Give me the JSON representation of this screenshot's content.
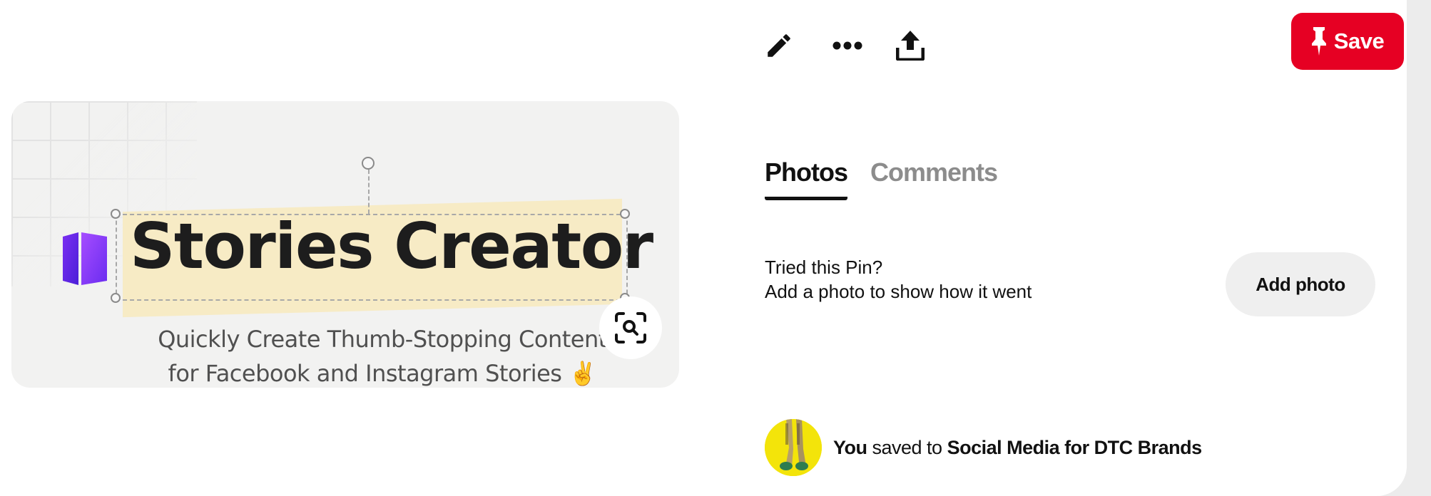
{
  "pin_image": {
    "title": "Stories Creator",
    "subtitle_line1": "Quickly Create Thumb-Stopping Content",
    "subtitle_line2": "for Facebook and Instagram Stories ✌️"
  },
  "toolbar": {
    "edit_icon": "pencil-icon",
    "more_icon": "ellipsis-icon",
    "share_icon": "share-upload-icon",
    "save_label": "Save",
    "save_color": "#e60023"
  },
  "tabs": [
    {
      "label": "Photos",
      "active": true
    },
    {
      "label": "Comments",
      "active": false
    }
  ],
  "tried": {
    "line1": "Tried this Pin?",
    "line2": "Add a photo to show how it went",
    "button_label": "Add photo"
  },
  "saved": {
    "user": "You",
    "middle": " saved to ",
    "board": "Social Media for DTC Brands"
  }
}
